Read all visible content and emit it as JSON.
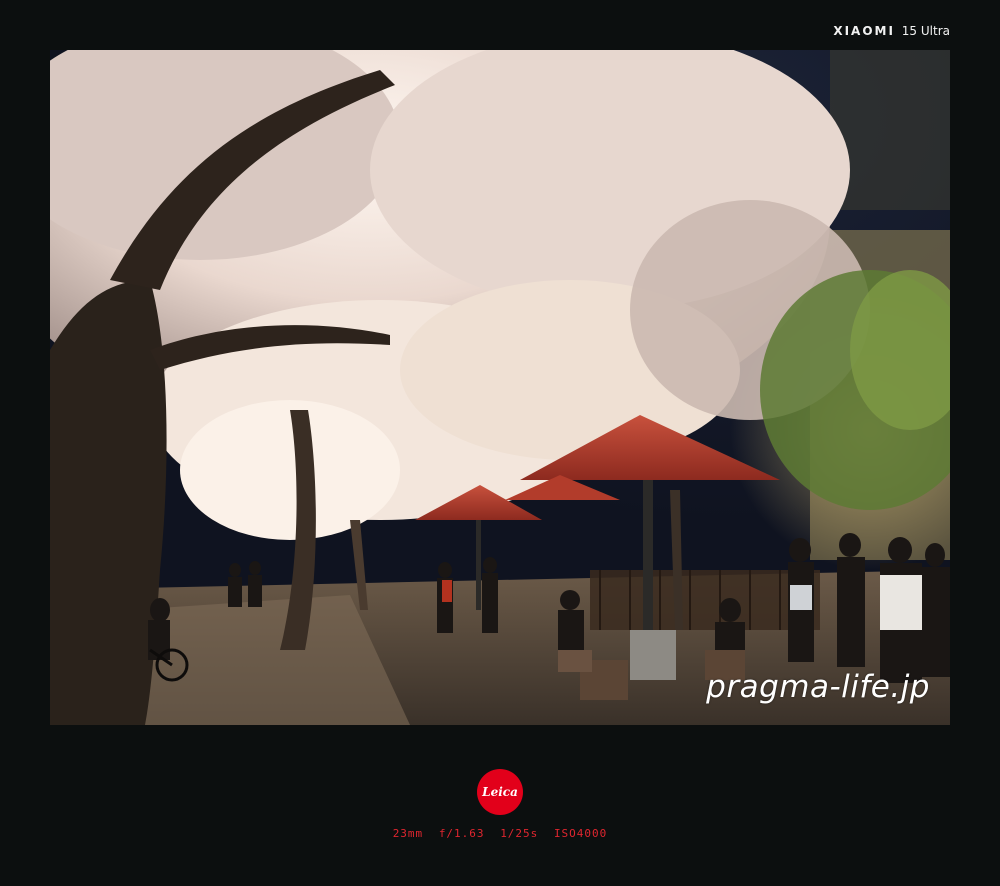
{
  "header": {
    "maker": "XIAOMI",
    "model": "15 Ultra"
  },
  "photo": {
    "watermark": "pragma-life.jp",
    "subject": "night cherry blossoms"
  },
  "footer": {
    "logo_text": "Leica",
    "logo_color": "#e2001a",
    "exif": {
      "focal_length": "23mm",
      "aperture": "f/1.63",
      "shutter": "1/25s",
      "iso": "ISO4000"
    },
    "exif_color": "#e0262f"
  }
}
